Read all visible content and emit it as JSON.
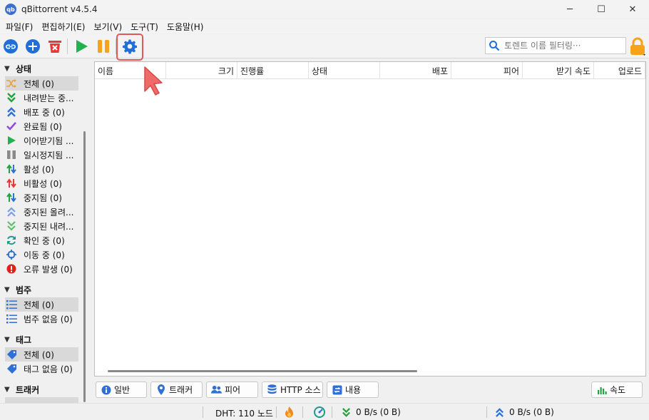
{
  "window": {
    "title": "qBittorrent v4.5.4",
    "app_icon_text": "qb",
    "minimize_glyph": "─",
    "maximize_glyph": "☐",
    "close_glyph": "✕"
  },
  "menu": [
    "파일(F)",
    "편집하기(E)",
    "보기(V)",
    "도구(T)",
    "도움말(H)"
  ],
  "toolbar": {
    "buttons": [
      "link-icon",
      "add-icon",
      "delete-icon",
      "resume-icon",
      "pause-icon",
      "gear-icon"
    ],
    "highlighted": "gear-icon",
    "filter_placeholder": "토렌트 이름 필터링···",
    "colors": {
      "blue": "#1f6fd6",
      "red": "#e53935",
      "green": "#22b14c",
      "orange": "#f7a21b",
      "highlight": "#e35757"
    }
  },
  "sidebar": {
    "status_header": "상태",
    "status_items": [
      {
        "label": "전체 (0)",
        "icon": "shuffle-icon",
        "selected": true
      },
      {
        "label": "내려받는 중...",
        "icon": "double-chevron-down-icon"
      },
      {
        "label": "배포 중 (0)",
        "icon": "double-chevron-up-icon"
      },
      {
        "label": "완료됨 (0)",
        "icon": "checkmark-icon"
      },
      {
        "label": "이어받기됨 ...",
        "icon": "play-icon"
      },
      {
        "label": "일시정지됨 ...",
        "icon": "pause-icon"
      },
      {
        "label": "활성 (0)",
        "icon": "active-arrows-icon"
      },
      {
        "label": "비활성 (0)",
        "icon": "inactive-arrows-icon"
      },
      {
        "label": "중지됨 (0)",
        "icon": "stalled-arrows-icon"
      },
      {
        "label": "중지된 올려...",
        "icon": "stalled-up-icon"
      },
      {
        "label": "중지된 내려...",
        "icon": "stalled-down-icon"
      },
      {
        "label": "확인 중 (0)",
        "icon": "refresh-icon"
      },
      {
        "label": "이동 중 (0)",
        "icon": "target-icon"
      },
      {
        "label": "오류 발생 (0)",
        "icon": "error-icon"
      }
    ],
    "category_header": "범주",
    "category_items": [
      {
        "label": "전체 (0)",
        "icon": "list-icon",
        "selected": true
      },
      {
        "label": "범주 없음 (0)",
        "icon": "list-icon"
      }
    ],
    "tag_header": "태그",
    "tag_items": [
      {
        "label": "전체 (0)",
        "icon": "tag-icon",
        "selected": true
      },
      {
        "label": "태그 없음 (0)",
        "icon": "tag-icon"
      }
    ],
    "tracker_header": "트래커"
  },
  "table": {
    "columns": [
      "이름",
      "크기",
      "진행률",
      "상태",
      "배포",
      "피어",
      "받기 속도",
      "업로드"
    ],
    "rows": []
  },
  "tabs": [
    {
      "label": "일반",
      "icon": "info-icon"
    },
    {
      "label": "트래커",
      "icon": "pin-icon"
    },
    {
      "label": "피어",
      "icon": "people-icon"
    },
    {
      "label": "HTTP 소스",
      "icon": "database-icon"
    },
    {
      "label": "내용",
      "icon": "content-icon"
    },
    {
      "label": "속도",
      "icon": "speed-chart-icon"
    }
  ],
  "status": {
    "dht": "DHT: 110 노드",
    "download": "0 B/s (0 B)",
    "upload": "0 B/s (0 B)"
  }
}
